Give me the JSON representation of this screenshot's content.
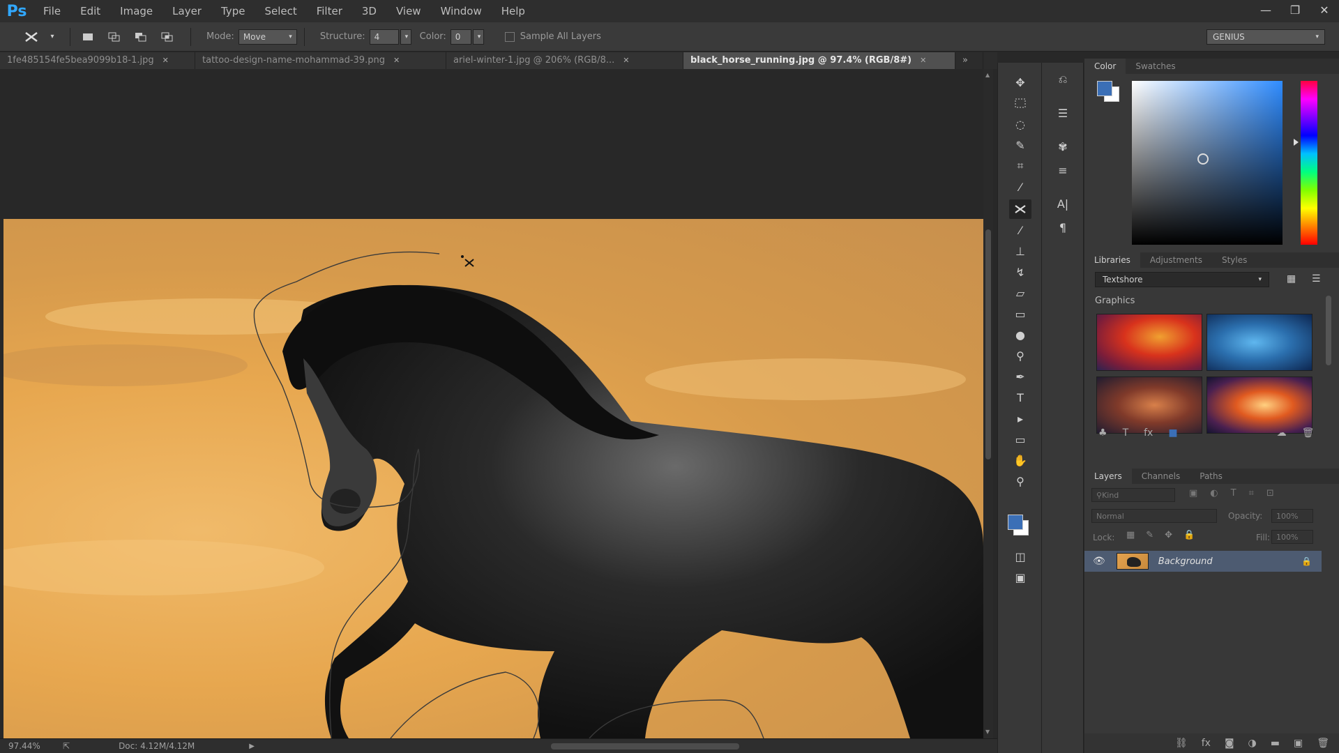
{
  "menu": {
    "logo": "Ps",
    "items": [
      "File",
      "Edit",
      "Image",
      "Layer",
      "Type",
      "Select",
      "Filter",
      "3D",
      "View",
      "Window",
      "Help"
    ]
  },
  "window_controls": [
    "—",
    "❐",
    "✕"
  ],
  "options": {
    "mode_label": "Mode:",
    "mode_value": "Move",
    "structure_label": "Structure:",
    "structure_value": "4",
    "color_label": "Color:",
    "color_value": "0",
    "sample_all_layers": "Sample All Layers",
    "workspace": "GENIUS"
  },
  "tabs": [
    {
      "label": "1fe485154fe5bea9099b18-1.jpg",
      "active": false
    },
    {
      "label": "tattoo-design-name-mohammad-39.png",
      "active": false
    },
    {
      "label": "ariel-winter-1.jpg @ 206% (RGB/8...",
      "active": false
    },
    {
      "label": "black_horse_running.jpg @ 97.4% (RGB/8#)",
      "active": true
    }
  ],
  "status": {
    "zoom": "97.44%",
    "doc": "Doc: 4.12M/4.12M"
  },
  "panels": {
    "color_tabs": [
      "Color",
      "Swatches"
    ],
    "library_tabs": [
      "Libraries",
      "Adjustments",
      "Styles"
    ],
    "library_name": "Textshore",
    "graphics_label": "Graphics",
    "layers_tabs": [
      "Layers",
      "Channels",
      "Paths"
    ],
    "kind_label": "Kind",
    "blend_mode": "Normal",
    "opacity_label": "Opacity:",
    "opacity_value": "100%",
    "lock_label": "Lock:",
    "fill_label": "Fill:",
    "fill_value": "100%",
    "layer_name": "Background"
  },
  "colors": {
    "foreground": "#3b6fb6",
    "background": "#ffffff",
    "sky": "#e6a651"
  }
}
